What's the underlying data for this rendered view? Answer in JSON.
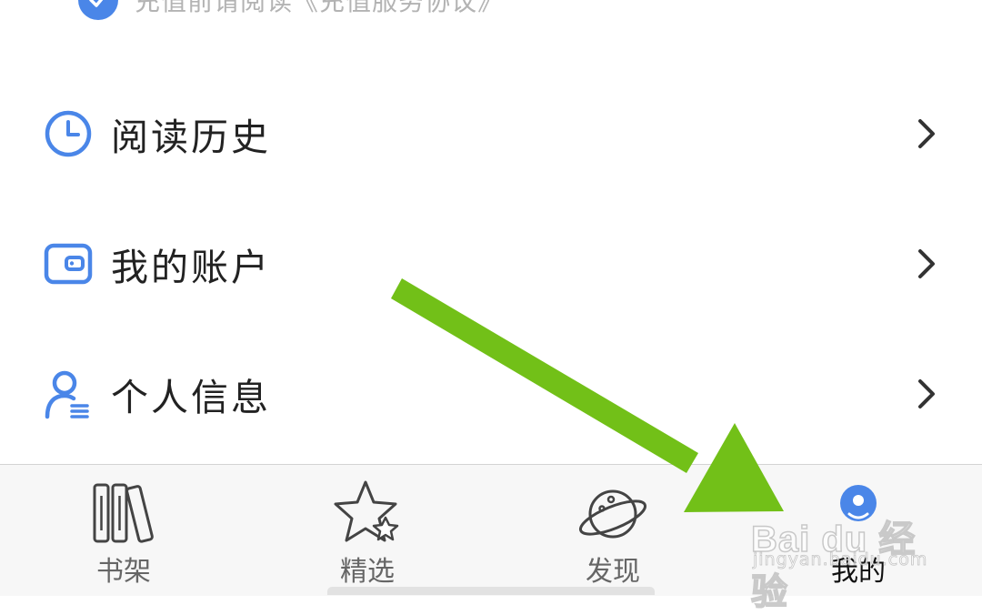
{
  "agreement": {
    "text": "充值前请阅读《充值服务协议》"
  },
  "menu": {
    "items": [
      {
        "label": "阅读历史",
        "icon": "clock-icon"
      },
      {
        "label": "我的账户",
        "icon": "wallet-icon"
      },
      {
        "label": "个人信息",
        "icon": "user-profile-icon"
      }
    ]
  },
  "tabbar": {
    "tabs": [
      {
        "label": "书架",
        "icon": "bookshelf-icon",
        "active": false
      },
      {
        "label": "精选",
        "icon": "star-icon",
        "active": false
      },
      {
        "label": "发现",
        "icon": "planet-icon",
        "active": false
      },
      {
        "label": "我的",
        "icon": "person-avatar-icon",
        "active": true
      }
    ]
  },
  "watermark": {
    "brand": "Bai du 经验",
    "url": "jingyan.baidu.com"
  },
  "colors": {
    "accent_blue": "#4a86e8",
    "annotation_green": "#72c018",
    "text_primary": "#222222",
    "text_muted": "#b3b3b3"
  }
}
